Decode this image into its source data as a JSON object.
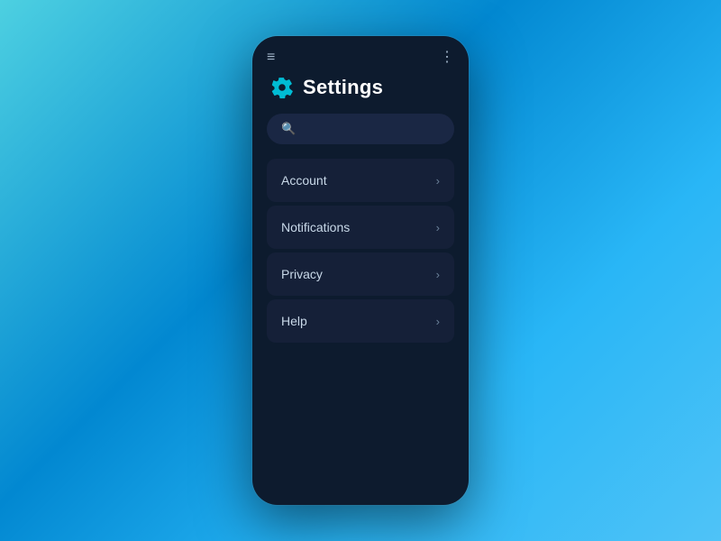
{
  "page": {
    "title": "Settings",
    "background_color": "#0d1b2e"
  },
  "header": {
    "hamburger_label": "≡",
    "more_label": "⋮"
  },
  "search": {
    "placeholder": "",
    "icon": "search"
  },
  "menu": {
    "items": [
      {
        "id": "account",
        "label": "Account",
        "chevron": "›"
      },
      {
        "id": "notifications",
        "label": "Notifications",
        "chevron": "›"
      },
      {
        "id": "privacy",
        "label": "Privacy",
        "chevron": "›"
      },
      {
        "id": "help",
        "label": "Help",
        "chevron": "›"
      }
    ]
  }
}
